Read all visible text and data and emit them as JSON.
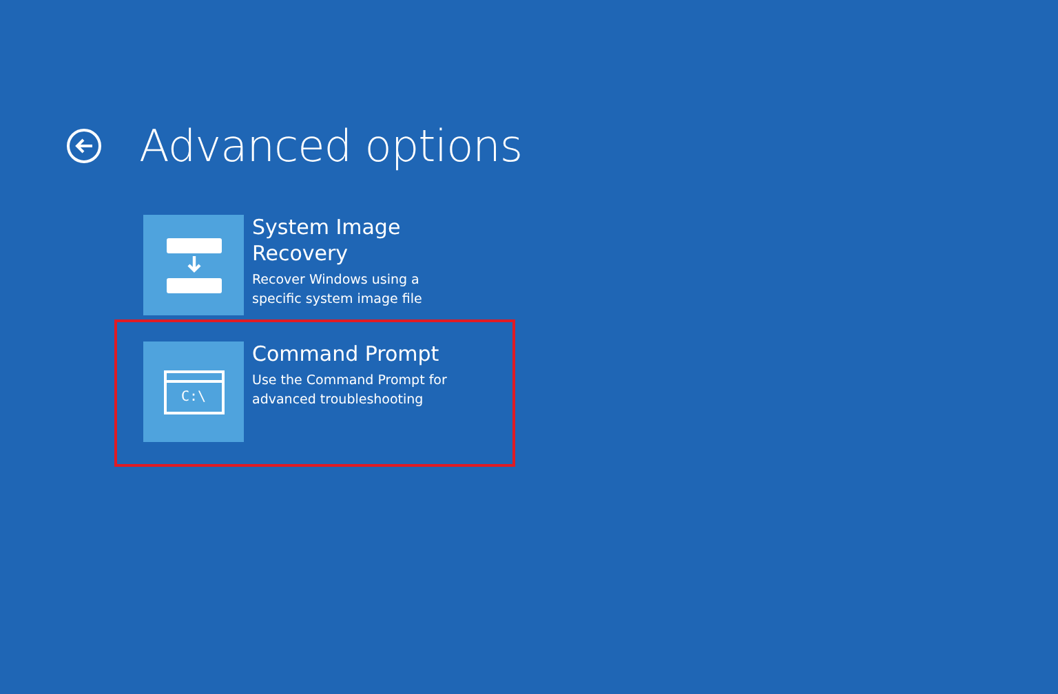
{
  "header": {
    "title": "Advanced options"
  },
  "options": [
    {
      "kind": "image-recovery",
      "title": "System Image Recovery",
      "description": "Recover Windows using a specific system image file",
      "highlighted": false
    },
    {
      "kind": "command-prompt",
      "icon_text": "C:\\",
      "title": "Command Prompt",
      "description": "Use the Command Prompt for advanced troubleshooting",
      "highlighted": true
    }
  ]
}
